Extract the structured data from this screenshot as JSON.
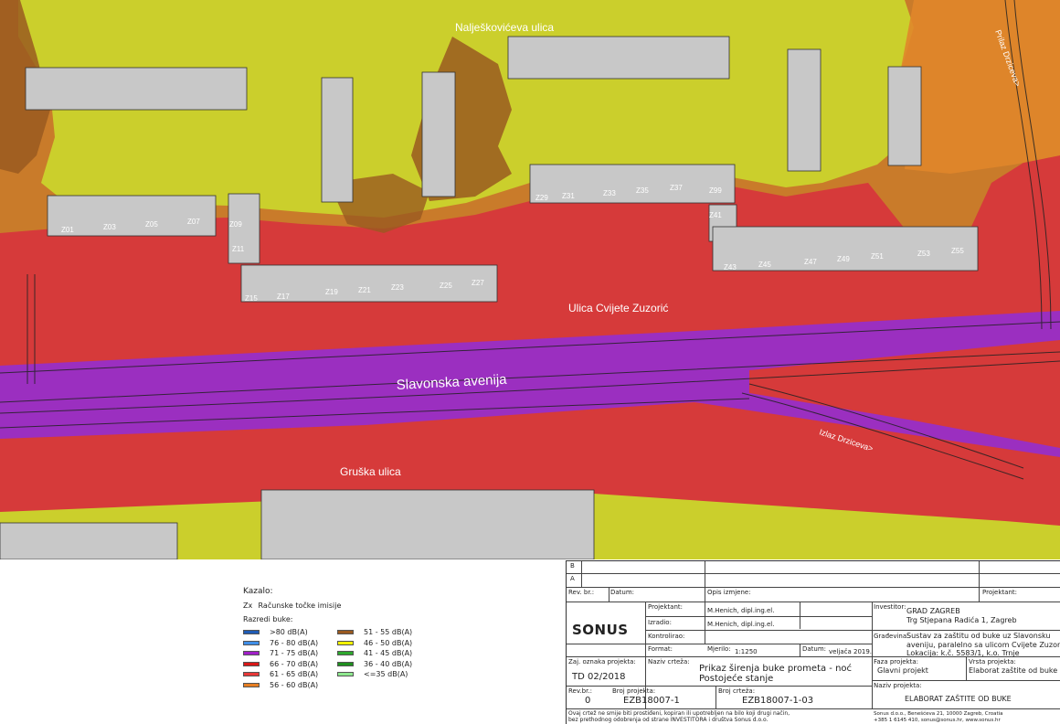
{
  "map": {
    "street_labels": {
      "najeskovic": "Nalješkovićeva ulica",
      "drziceva_in": "Prilaz Drziceva>",
      "cvijete": "Ulica Cvijete Zuzorić",
      "slavonska": "Slavonska avenija",
      "drziceva_out": "Izlaz Drziceva>",
      "gruska": "Gruška ulica"
    },
    "points": [
      "Z01",
      "Z03",
      "Z05",
      "Z07",
      "Z09",
      "Z11",
      "Z15",
      "Z17",
      "Z19",
      "Z21",
      "Z23",
      "Z25",
      "Z27",
      "Z29",
      "Z31",
      "Z33",
      "Z35",
      "Z37",
      "Z99",
      "Z41",
      "Z43",
      "Z45",
      "Z47",
      "Z49",
      "Z51",
      "Z53",
      "Z55"
    ]
  },
  "legend": {
    "title": "Kazalo:",
    "calc_prefix": "Zx",
    "calc_label": "Računske točke imisije",
    "classes_title": "Razredi buke:",
    "classes": [
      {
        "label": ">80 dB(A)",
        "color": "#1f5cb5"
      },
      {
        "label": "76 - 80 dB(A)",
        "color": "#3f8ee8"
      },
      {
        "label": "71 - 75 dB(A)",
        "color": "#a020c8"
      },
      {
        "label": "66 - 70 dB(A)",
        "color": "#d81818"
      },
      {
        "label": "61 - 65 dB(A)",
        "color": "#e83838"
      },
      {
        "label": "56 - 60 dB(A)",
        "color": "#e67e22"
      },
      {
        "label": "51 - 55 dB(A)",
        "color": "#9a5a20"
      },
      {
        "label": "46 - 50 dB(A)",
        "color": "#f2f200"
      },
      {
        "label": "41 - 45 dB(A)",
        "color": "#2ea82e"
      },
      {
        "label": "36 - 40 dB(A)",
        "color": "#1f8f1f"
      },
      {
        "label": "<=35 dB(A)",
        "color": "#8ee88e"
      }
    ]
  },
  "titleblock": {
    "rev_b": "B",
    "rev_a": "A",
    "rev_no": "Rev. br.:",
    "datum": "Datum:",
    "opis": "Opis izmjene:",
    "projektant_hdr": "Projektant:",
    "logo": "SONUS",
    "projektant": "Projektant:",
    "projektant_val": "M.Henich, dipl.ing.el.",
    "izradio": "Izradio:",
    "izradio_val": "M.Henich, dipl.ing.el.",
    "kontrolirao": "Kontrolirao:",
    "format": "Format:",
    "mjerilo": "Mjerilo:",
    "mjerilo_val": "1:1250",
    "datum2": "Datum:",
    "datum_val": "veljača 2019.",
    "investitor": "Investitor:",
    "investitor_val1": "GRAD ZAGREB",
    "investitor_val2": "Trg Stjepana Radića 1, Zagreb",
    "gradevina": "Građevina:",
    "gradevina_val1": "Sustav za zaštitu od buke uz Slavonsku",
    "gradevina_val2": "aveniju, paralelno sa ulicom Cvijete Zuzorić",
    "gradevina_val3": "Lokacija: k.č. 5583/1, k.o. Trnje",
    "zaj_oznaka": "Zaj. oznaka projekta:",
    "zaj_val": "TD 02/2018",
    "naziv_crteza": "Naziv crteža:",
    "naziv_crteza_val1": "Prikaz širenja buke prometa - noć",
    "naziv_crteza_val2": "Postojeće stanje",
    "faza": "Faza projekta:",
    "faza_val": "Glavni projekt",
    "vrsta": "Vrsta projekta:",
    "vrsta_val": "Elaborat zaštite od buke",
    "rev_br2": "Rev.br.:",
    "rev_val": "0",
    "broj_projekta": "Broj projekta:",
    "broj_projekta_val": "EZB18007-1",
    "broj_crteza": "Broj crteža:",
    "broj_crteza_val": "EZB18007-1-03",
    "naziv_projekta": "Naziv projekta:",
    "naziv_projekta_val": "ELABORAT ZAŠTITE OD BUKE",
    "note1": "Ovaj crtež ne smije biti prostiđeni, kopiran ili upotrebljen na bilo koji drugi način,",
    "note2": "bez prethodnog odobrenja od strane INVESTITORA i  društva Sonus d.o.o.",
    "sonus1": "Sonus d.o.o., Benešćeva 21, 10000 Zagreb, Croatia",
    "sonus2": "+385 1 6145 410, sonus@sonus.hr, www.sonus.hr"
  }
}
